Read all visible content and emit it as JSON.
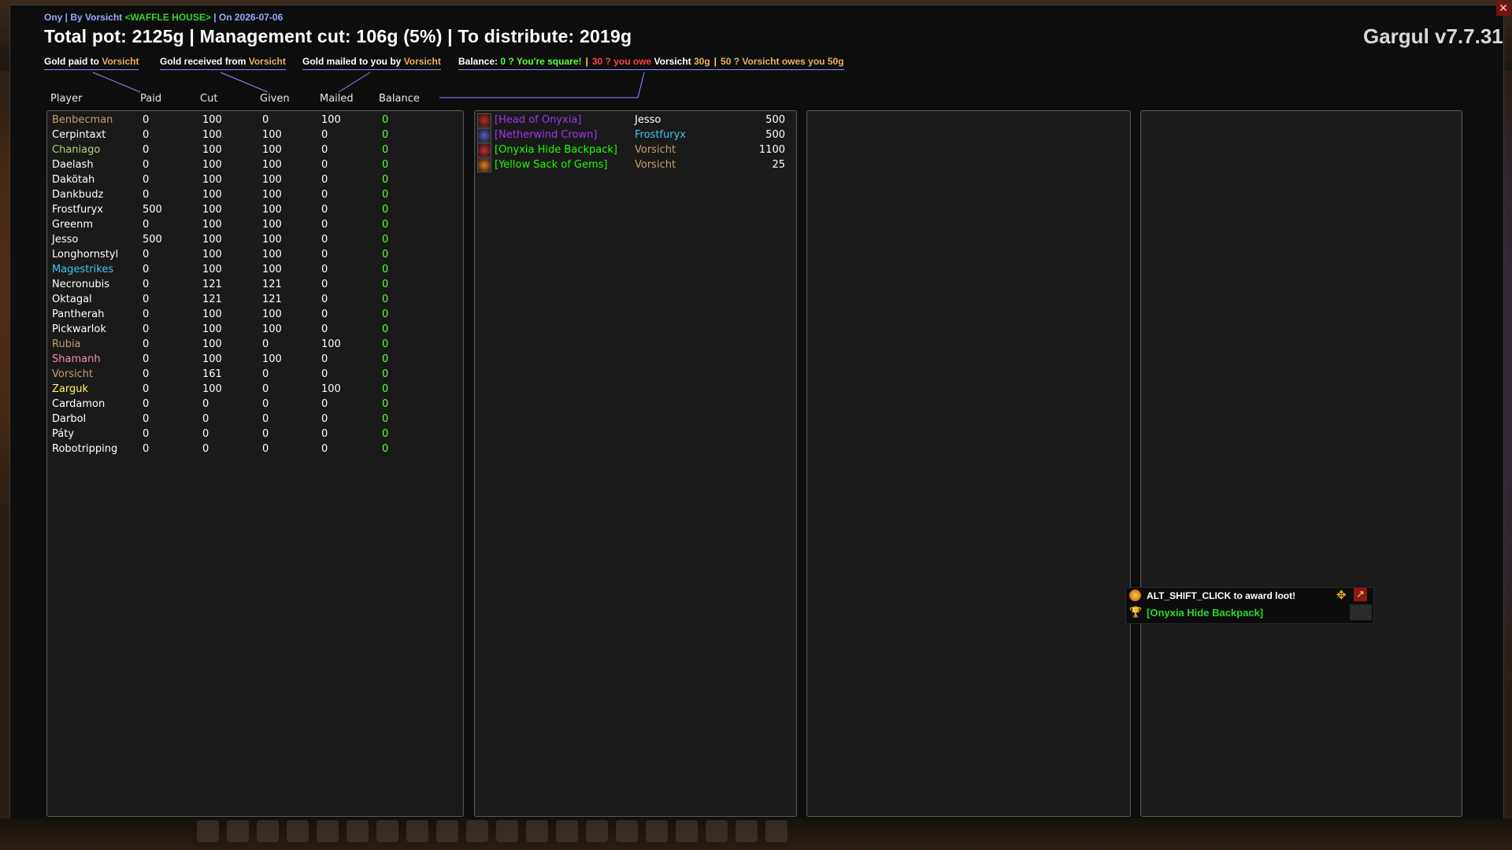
{
  "meta": {
    "prefix": "Ony | By Vorsicht ",
    "guild": "<WAFFLE HOUSE>",
    "date": " | On 2026-07-06"
  },
  "title": "Total pot: 2125g | Management cut: 106g (5%) | To distribute: 2019g",
  "version": "Gargul v7.7.31",
  "tabs": {
    "paid": {
      "label": "Gold paid to ",
      "name": "Vorsicht"
    },
    "received": {
      "label": "Gold received from ",
      "name": "Vorsicht"
    },
    "mailed": {
      "label": "Gold mailed to you by ",
      "name": "Vorsicht"
    }
  },
  "balance": {
    "label": "Balance:",
    "square": "0 ? You're square!",
    "sep": "|",
    "owe_pre": "30 ? you owe ",
    "owe_name": "Vorsicht",
    "owe_amount": " 30g",
    "owes_text": "50 ? Vorsicht owes you 50g"
  },
  "columns": {
    "player": "Player",
    "paid": "Paid",
    "cut": "Cut",
    "given": "Given",
    "mailed": "Mailed",
    "balance": "Balance"
  },
  "players": [
    {
      "name": "Benbecman",
      "paid": "0",
      "cut": "100",
      "given": "0",
      "mailed": "100",
      "balance": "0",
      "color": "#c69b6d"
    },
    {
      "name": "Cerpintaxt",
      "paid": "0",
      "cut": "100",
      "given": "100",
      "mailed": "0",
      "balance": "0",
      "color": "#ffffff"
    },
    {
      "name": "Chaniago",
      "paid": "0",
      "cut": "100",
      "given": "100",
      "mailed": "0",
      "balance": "0",
      "color": "#aad372"
    },
    {
      "name": "Daelash",
      "paid": "0",
      "cut": "100",
      "given": "100",
      "mailed": "0",
      "balance": "0",
      "color": "#ffffff"
    },
    {
      "name": "Dakötah",
      "paid": "0",
      "cut": "100",
      "given": "100",
      "mailed": "0",
      "balance": "0",
      "color": "#ffffff"
    },
    {
      "name": "Dankbudz",
      "paid": "0",
      "cut": "100",
      "given": "100",
      "mailed": "0",
      "balance": "0",
      "color": "#ffffff"
    },
    {
      "name": "Frostfuryx",
      "paid": "500",
      "cut": "100",
      "given": "100",
      "mailed": "0",
      "balance": "0",
      "color": "#ffffff"
    },
    {
      "name": "Greenm",
      "paid": "0",
      "cut": "100",
      "given": "100",
      "mailed": "0",
      "balance": "0",
      "color": "#ffffff"
    },
    {
      "name": "Jesso",
      "paid": "500",
      "cut": "100",
      "given": "100",
      "mailed": "0",
      "balance": "0",
      "color": "#ffffff"
    },
    {
      "name": "Longhornstyl",
      "paid": "0",
      "cut": "100",
      "given": "100",
      "mailed": "0",
      "balance": "0",
      "color": "#ffffff"
    },
    {
      "name": "Magestrikes",
      "paid": "0",
      "cut": "100",
      "given": "100",
      "mailed": "0",
      "balance": "0",
      "color": "#3fc7eb"
    },
    {
      "name": "Necronubis",
      "paid": "0",
      "cut": "121",
      "given": "121",
      "mailed": "0",
      "balance": "0",
      "color": "#ffffff"
    },
    {
      "name": "Oktagal",
      "paid": "0",
      "cut": "121",
      "given": "121",
      "mailed": "0",
      "balance": "0",
      "color": "#ffffff"
    },
    {
      "name": "Pantherah",
      "paid": "0",
      "cut": "100",
      "given": "100",
      "mailed": "0",
      "balance": "0",
      "color": "#ffffff"
    },
    {
      "name": "Pickwarlok",
      "paid": "0",
      "cut": "100",
      "given": "100",
      "mailed": "0",
      "balance": "0",
      "color": "#ffffff"
    },
    {
      "name": "Rubia",
      "paid": "0",
      "cut": "100",
      "given": "0",
      "mailed": "100",
      "balance": "0",
      "color": "#c69b6d"
    },
    {
      "name": "Shamanh",
      "paid": "0",
      "cut": "100",
      "given": "100",
      "mailed": "0",
      "balance": "0",
      "color": "#f48cba"
    },
    {
      "name": "Vorsicht",
      "paid": "0",
      "cut": "161",
      "given": "0",
      "mailed": "0",
      "balance": "0",
      "color": "#c69b6d"
    },
    {
      "name": "Zarguk",
      "paid": "0",
      "cut": "100",
      "given": "0",
      "mailed": "100",
      "balance": "0",
      "color": "#fff468"
    },
    {
      "name": "Cardamon",
      "paid": "0",
      "cut": "0",
      "given": "0",
      "mailed": "0",
      "balance": "0",
      "color": "#ffffff"
    },
    {
      "name": "Darbol",
      "paid": "0",
      "cut": "0",
      "given": "0",
      "mailed": "0",
      "balance": "0",
      "color": "#ffffff"
    },
    {
      "name": "Páty",
      "paid": "0",
      "cut": "0",
      "given": "0",
      "mailed": "0",
      "balance": "0",
      "color": "#ffffff"
    },
    {
      "name": "Robotripping",
      "paid": "0",
      "cut": "0",
      "given": "0",
      "mailed": "0",
      "balance": "0",
      "color": "#ffffff"
    }
  ],
  "loot": [
    {
      "item": "[Head of Onyxia]",
      "item_color": "#a335ee",
      "winner": "Jesso",
      "winner_color": "#ffffff",
      "price": "500",
      "icon": "onyxia-head-icon",
      "icon_color": "#b03020"
    },
    {
      "item": "[Netherwind Crown]",
      "item_color": "#a335ee",
      "winner": "Frostfuryx",
      "winner_color": "#3fc7eb",
      "price": "500",
      "icon": "crown-icon",
      "icon_color": "#5060c0"
    },
    {
      "item": "[Onyxia Hide Backpack]",
      "item_color": "#1eff00",
      "winner": "Vorsicht",
      "winner_color": "#c69b6d",
      "price": "1100",
      "icon": "backpack-icon",
      "icon_color": "#c03030"
    },
    {
      "item": "[Yellow Sack of Gems]",
      "item_color": "#1eff00",
      "winner": "Vorsicht",
      "winner_color": "#c69b6d",
      "price": "25",
      "icon": "gem-sack-icon",
      "icon_color": "#e08020"
    }
  ],
  "tooltip": {
    "hint": "ALT_SHIFT_CLICK to award loot!",
    "item": "[Onyxia Hide Backpack]"
  }
}
